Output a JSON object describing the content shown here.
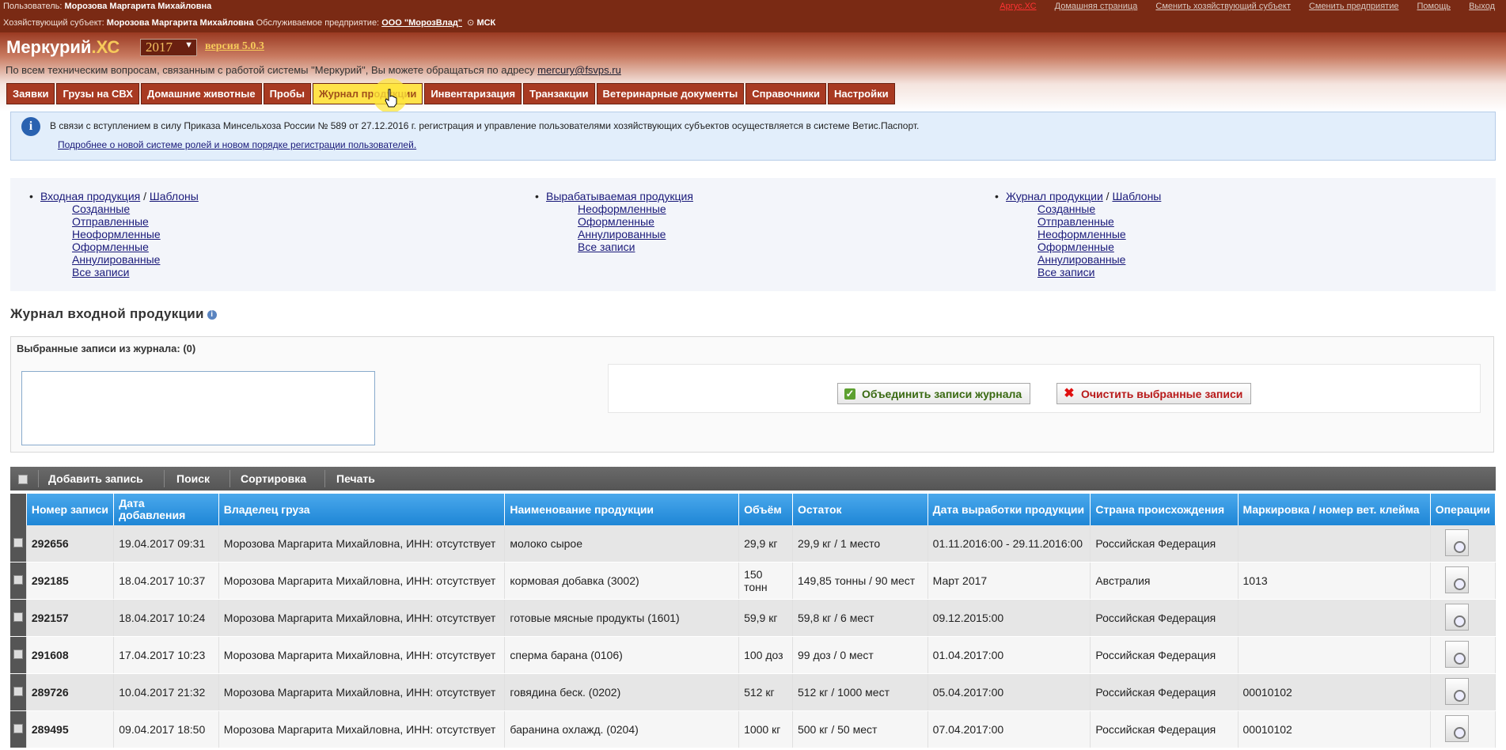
{
  "topbar": {
    "user_label": "Пользователь:",
    "user_name": "Морозова Маргарита Михайловна",
    "entity_label": "Хозяйствующий субъект:",
    "entity_name": "Морозова Маргарита Михайловна",
    "enterprise_label": "Обслуживаемое предприятие:",
    "enterprise_name": "ООО \"МорозВлад\"",
    "timezone": "МСК",
    "links": [
      "Аргус.ХС",
      "Домашняя страница",
      "Сменить хозяйствующий субъект",
      "Сменить предприятие",
      "Помощь",
      "Выход"
    ]
  },
  "header": {
    "logo_main": "Меркурий",
    "logo_suffix": ".ХС",
    "year": "2017",
    "version": "версия 5.0.3",
    "support_text": "По всем техническим вопросам, связанным с работой системы \"Меркурий\", Вы можете обращаться по адресу",
    "support_email": "mercury@fsvps.ru"
  },
  "nav": [
    "Заявки",
    "Грузы на СВХ",
    "Домашние животные",
    "Пробы",
    "Журнал продукции",
    "Инвентаризация",
    "Транзакции",
    "Ветеринарные документы",
    "Справочники",
    "Настройки"
  ],
  "info": {
    "text": "В связи с вступлением в силу Приказа Минсельхоза России № 589 от 27.12.2016 г. регистрация и управление пользователями хозяйствующих субъектов осуществляется в системе Ветис.Паспорт.",
    "link": "Подробнее о новой системе ролей и новом порядке регистрации пользователей."
  },
  "links_panel": {
    "col1": {
      "head": "Входная продукция",
      "head2": "Шаблоны",
      "items": [
        "Созданные",
        "Отправленные",
        "Неоформленные",
        "Оформленные",
        "Аннулированные",
        "Все записи"
      ]
    },
    "col2": {
      "head": "Вырабатываемая продукция",
      "items": [
        "Неоформленные",
        "Оформленные",
        "Аннулированные",
        "Все записи"
      ]
    },
    "col3": {
      "head": "Журнал продукции",
      "head2": "Шаблоны",
      "items": [
        "Созданные",
        "Отправленные",
        "Неоформленные",
        "Оформленные",
        "Аннулированные",
        "Все записи"
      ]
    }
  },
  "journal": {
    "title": "Журнал входной продукции",
    "selected_label": "Выбранные записи из журнала: (0)",
    "merge_button": "Объединить записи журнала",
    "clear_button": "Очистить выбранные записи"
  },
  "toolbar": [
    "Добавить запись",
    "Поиск",
    "Сортировка",
    "Печать"
  ],
  "table": {
    "columns": [
      "Номер записи",
      "Дата добавления",
      "Владелец груза",
      "Наименование продукции",
      "Объём",
      "Остаток",
      "Дата выработки продукции",
      "Страна происхождения",
      "Маркировка / номер вет. клейма",
      "Операции"
    ],
    "rows": [
      [
        "292656",
        "19.04.2017 09:31",
        "Морозова Маргарита Михайловна, ИНН: отсутствует",
        "молоко сырое",
        "29,9 кг",
        "29,9 кг / 1 место",
        "01.11.2016:00 - 29.11.2016:00",
        "Российская Федерация",
        ""
      ],
      [
        "292185",
        "18.04.2017 10:37",
        "Морозова Маргарита Михайловна, ИНН: отсутствует",
        "кормовая добавка (3002)",
        "150 тонн",
        "149,85 тонны / 90 мест",
        "Март 2017",
        "Австралия",
        "1013"
      ],
      [
        "292157",
        "18.04.2017 10:24",
        "Морозова Маргарита Михайловна, ИНН: отсутствует",
        "готовые мясные продукты (1601)",
        "59,9 кг",
        "59,8 кг / 6 мест",
        "09.12.2015:00",
        "Российская Федерация",
        ""
      ],
      [
        "291608",
        "17.04.2017 10:23",
        "Морозова Маргарита Михайловна, ИНН: отсутствует",
        "сперма барана (0106)",
        "100 доз",
        "99 доз / 0 мест",
        "01.04.2017:00",
        "Российская Федерация",
        ""
      ],
      [
        "289726",
        "10.04.2017 21:32",
        "Морозова Маргарита Михайловна, ИНН: отсутствует",
        "говядина беск. (0202)",
        "512 кг",
        "512 кг / 1000 мест",
        "05.04.2017:00",
        "Российская Федерация",
        "00010102"
      ],
      [
        "289495",
        "09.04.2017 18:50",
        "Морозова Маргарита Михайловна, ИНН: отсутствует",
        "баранина охлажд. (0204)",
        "1000 кг",
        "500 кг / 50 мест",
        "07.04.2017:00",
        "Российская Федерация",
        "00010102"
      ]
    ]
  }
}
